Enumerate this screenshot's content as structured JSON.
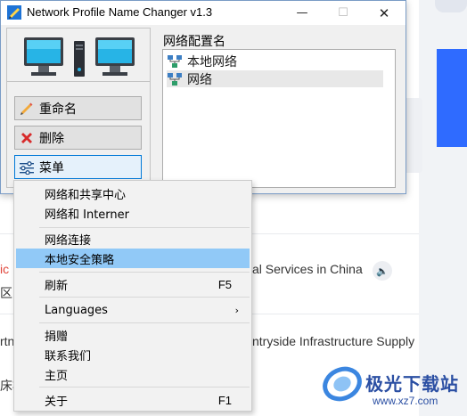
{
  "window": {
    "title": "Network Profile Name Changer v1.3",
    "controls": {
      "minimize": "—",
      "maximize": "☐",
      "close": "✕"
    }
  },
  "left_panel": {
    "buttons": [
      {
        "label": "重命名",
        "icon": "pencil-icon"
      },
      {
        "label": "删除",
        "icon": "red-x-icon"
      },
      {
        "label": "菜单",
        "icon": "sliders-icon"
      }
    ]
  },
  "right_panel": {
    "label": "网络配置名",
    "profiles": [
      {
        "name": "本地网络",
        "icon": "network-icon",
        "selected": false
      },
      {
        "name": "网络",
        "icon": "network-icon",
        "selected": true
      }
    ]
  },
  "context_menu": {
    "items": [
      {
        "label": "网络和共享中心",
        "shortcut": ""
      },
      {
        "label": "网络和 Interner",
        "shortcut": ""
      },
      {
        "label": "网络连接",
        "shortcut": ""
      },
      {
        "label": "本地安全策略",
        "shortcut": ""
      },
      {
        "label": "刷新",
        "shortcut": "F5"
      },
      {
        "label": "Languages",
        "shortcut": "",
        "submenu": true
      },
      {
        "label": "捐赠",
        "shortcut": ""
      },
      {
        "label": "联系我们",
        "shortcut": ""
      },
      {
        "label": "主页",
        "shortcut": ""
      },
      {
        "label": "关于",
        "shortcut": "F1"
      }
    ],
    "highlighted_index": 3
  },
  "background_page": {
    "fragments": [
      {
        "text": "ic",
        "color": "red"
      },
      {
        "text": "al Services in China"
      },
      {
        "text": "区国"
      },
      {
        "text": "ntryside Infrastructure Supply"
      },
      {
        "text": "rtn"
      },
      {
        "text": "床模"
      }
    ]
  },
  "watermark": {
    "brand": "极光下载站",
    "url": "www.xz7.com"
  },
  "colors": {
    "accent_blue": "#2f6bff",
    "menu_highlight": "#91c9f7",
    "window_border": "#7a9cc6"
  }
}
